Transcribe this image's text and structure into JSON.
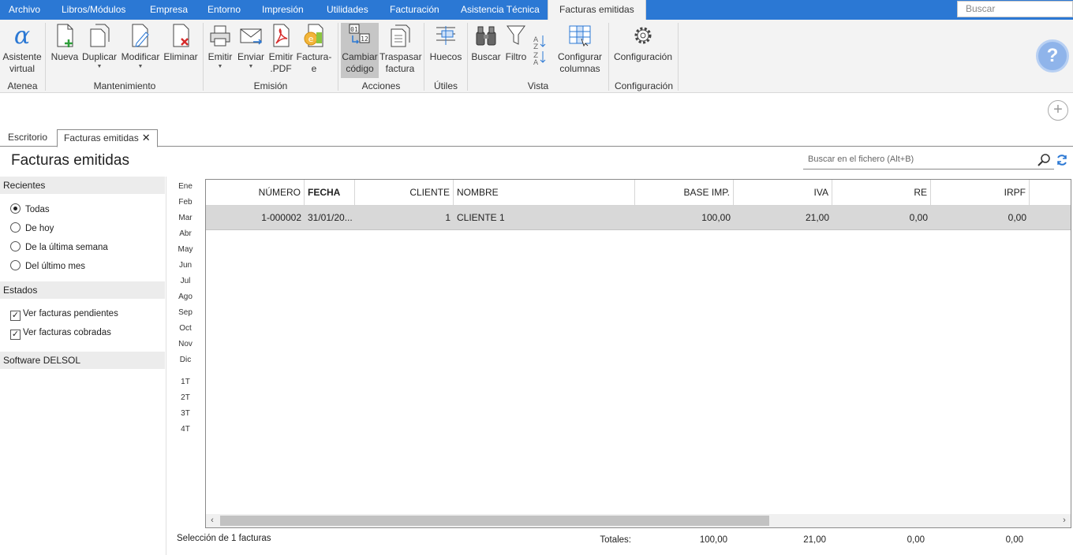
{
  "menubar": {
    "items": [
      "Archivo",
      "Libros/Módulos",
      "Empresa",
      "Entorno",
      "Impresión",
      "Utilidades",
      "Facturación",
      "Asistencia Técnica",
      "Facturas emitidas"
    ],
    "search_placeholder": "Buscar"
  },
  "ribbon": {
    "buttons": {
      "asistente": "Asistente",
      "asistente2": "virtual",
      "nueva": "Nueva",
      "duplicar": "Duplicar",
      "modificar": "Modificar",
      "eliminar": "Eliminar",
      "emitir": "Emitir",
      "enviar": "Enviar",
      "emitir_pdf": "Emitir",
      "emitir_pdf2": ".PDF",
      "facturae": "Factura-",
      "facturae2": "e",
      "cambiar": "Cambiar",
      "cambiar2": "código",
      "traspasar": "Traspasar",
      "traspasar2": "factura",
      "huecos": "Huecos",
      "buscar": "Buscar",
      "filtro": "Filtro",
      "configurar": "Configurar",
      "configurar2": "columnas",
      "configuracion": "Configuración"
    },
    "groups": {
      "atenea": "Atenea",
      "mantenimiento": "Mantenimiento",
      "emision": "Emisión",
      "acciones": "Acciones",
      "utiles": "Útiles",
      "vista": "Vista",
      "configuracion": "Configuración"
    }
  },
  "tabs": {
    "escritorio": "Escritorio",
    "facturas": "Facturas emitidas"
  },
  "page": {
    "title": "Facturas emitidas",
    "search_placeholder": "Buscar en el fichero (Alt+B)"
  },
  "filters": {
    "recientes_title": "Recientes",
    "recientes": [
      "Todas",
      "De hoy",
      "De la última semana",
      "Del último mes"
    ],
    "estados_title": "Estados",
    "estados": [
      "Ver facturas pendientes",
      "Ver facturas cobradas"
    ],
    "software_title": "Software DELSOL"
  },
  "months": [
    "Ene",
    "Feb",
    "Mar",
    "Abr",
    "May",
    "Jun",
    "Jul",
    "Ago",
    "Sep",
    "Oct",
    "Nov",
    "Dic"
  ],
  "quarters": [
    "1T",
    "2T",
    "3T",
    "4T"
  ],
  "grid": {
    "columns": [
      "NÚMERO",
      "FECHA",
      "CLIENTE",
      "NOMBRE",
      "BASE IMP.",
      "IVA",
      "RE",
      "IRPF"
    ],
    "rows": [
      [
        "1-000002",
        "31/01/20...",
        "1",
        "CLIENTE 1",
        "100,00",
        "21,00",
        "0,00",
        "0,00"
      ]
    ]
  },
  "footer": {
    "selection": "Selección de 1 facturas",
    "totales_label": "Totales:",
    "base": "100,00",
    "iva": "21,00",
    "re": "0,00",
    "irpf": "0,00"
  }
}
